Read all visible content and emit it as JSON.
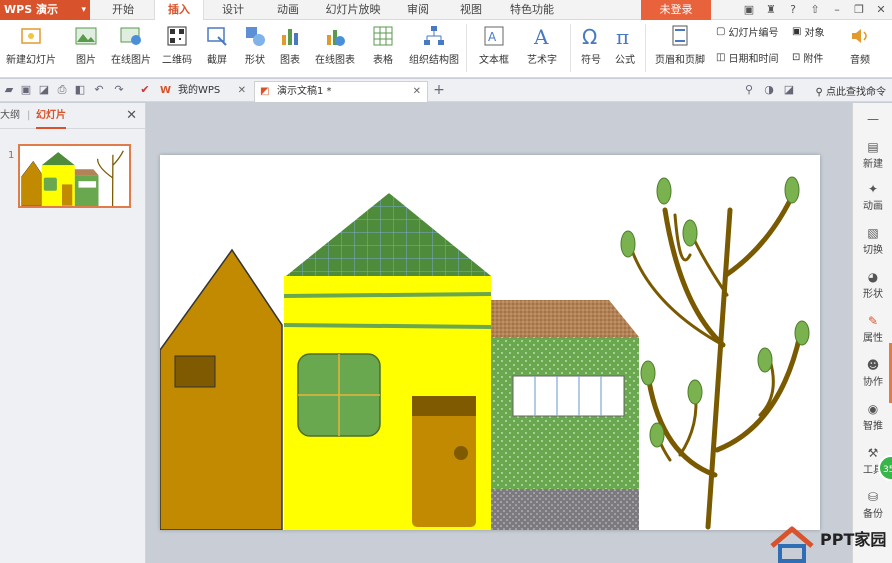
{
  "app": {
    "name": "WPS 演示"
  },
  "menu": {
    "tabs": [
      "开始",
      "插入",
      "设计",
      "动画",
      "幻灯片放映",
      "审阅",
      "视图",
      "特色功能"
    ],
    "active_tab": "插入",
    "login_label": "未登录"
  },
  "ribbon": {
    "buttons": [
      {
        "label": "新建幻灯片",
        "icon": "new-slide-icon"
      },
      {
        "label": "图片",
        "icon": "picture-icon"
      },
      {
        "label": "在线图片",
        "icon": "online-picture-icon"
      },
      {
        "label": "二维码",
        "icon": "qr-code-icon"
      },
      {
        "label": "截屏",
        "icon": "screenshot-icon"
      },
      {
        "label": "形状",
        "icon": "shapes-icon"
      },
      {
        "label": "图表",
        "icon": "chart-icon"
      },
      {
        "label": "在线图表",
        "icon": "online-chart-icon"
      },
      {
        "label": "表格",
        "icon": "table-icon"
      },
      {
        "label": "组织结构图",
        "icon": "org-chart-icon"
      },
      {
        "label": "文本框",
        "icon": "text-box-icon"
      },
      {
        "label": "艺术字",
        "icon": "word-art-icon"
      },
      {
        "label": "符号",
        "icon": "symbol-icon"
      },
      {
        "label": "公式",
        "icon": "formula-icon"
      },
      {
        "label": "页眉和页脚",
        "icon": "header-footer-icon"
      }
    ],
    "small_buttons": [
      {
        "label": "幻灯片编号",
        "icon": "slide-number-icon"
      },
      {
        "label": "对象",
        "icon": "object-icon"
      },
      {
        "label": "日期和时间",
        "icon": "date-time-icon"
      },
      {
        "label": "附件",
        "icon": "attachment-icon"
      }
    ],
    "audio_label": "音频"
  },
  "doc_tabs": [
    {
      "label": "我的WPS",
      "active": false
    },
    {
      "label": "演示文稿1 *",
      "active": true
    }
  ],
  "search_hint": "点此查找命令",
  "left_panel": {
    "tab_outline": "大纲",
    "tab_slides": "幻灯片",
    "slide_number": "1"
  },
  "right_panel": {
    "items": [
      "新建",
      "动画",
      "切换",
      "形状",
      "属性",
      "协作",
      "智推",
      "工具",
      "备份"
    ]
  },
  "badge": "35",
  "watermark": {
    "text": "PPT家园"
  },
  "colors": {
    "accent": "#d8532b",
    "house_brown": "#c28a00",
    "house_yellow": "#ffff00",
    "roof_green": "#4e8b3a",
    "house_green": "#6aa84f",
    "roof_brick": "#b38257",
    "tree_brown": "#7a5a00",
    "leaf_green": "#7ab24f"
  }
}
